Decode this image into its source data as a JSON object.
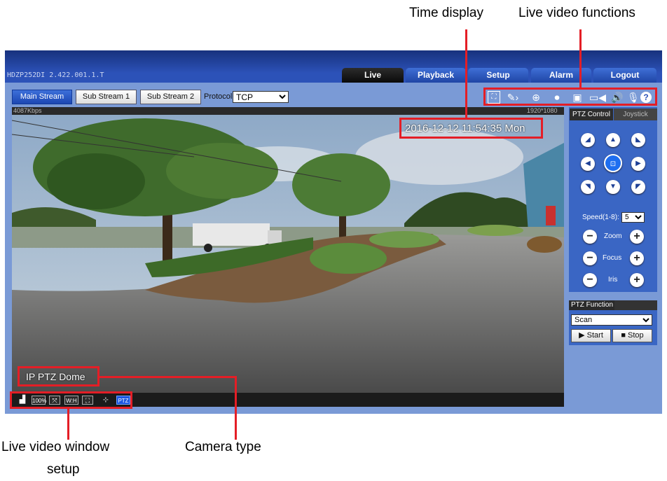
{
  "callouts": {
    "time_display": "Time display",
    "live_video_functions": "Live video functions",
    "live_video_window_setup_line1": "Live video window",
    "live_video_window_setup_line2": "setup",
    "camera_type": "Camera type"
  },
  "app": {
    "device_info": "HDZP252DI   2.422.001.1.T",
    "nav_tabs": [
      "Live",
      "Playback",
      "Setup",
      "Alarm",
      "Logout"
    ],
    "active_tab": "Live"
  },
  "stream": {
    "buttons": [
      "Main Stream",
      "Sub Stream 1",
      "Sub Stream 2"
    ],
    "active": "Main Stream",
    "protocol_label": "Protocol",
    "protocol_value": "TCP"
  },
  "toolbar_icons": [
    "fullscreen-icon",
    "pen-icon",
    "zoom-icon",
    "record-icon",
    "snapshot-icon",
    "video-icon",
    "audio-icon",
    "microphone-icon",
    "help-icon"
  ],
  "video": {
    "bitrate": "4087Kbps",
    "resolution": "1920*1080",
    "timestamp": "2016-12-12 11:54:35 Mon",
    "camera_type": "IP PTZ Dome"
  },
  "video_window_controls": [
    "original-size",
    "100%",
    "fit",
    "W:H",
    "full",
    "zoom",
    "PTZ"
  ],
  "ptz": {
    "tabs": [
      "PTZ Control",
      "Joystick"
    ],
    "speed_label": "Speed(1-8):",
    "speed_value": "5",
    "zoom_label": "Zoom",
    "focus_label": "Focus",
    "iris_label": "Iris"
  },
  "ptz_function": {
    "title": "PTZ Function",
    "selected": "Scan",
    "start_label": "Start",
    "stop_label": "Stop"
  },
  "colors": {
    "accent": "#2c52b8",
    "highlight": "#e41e26"
  }
}
